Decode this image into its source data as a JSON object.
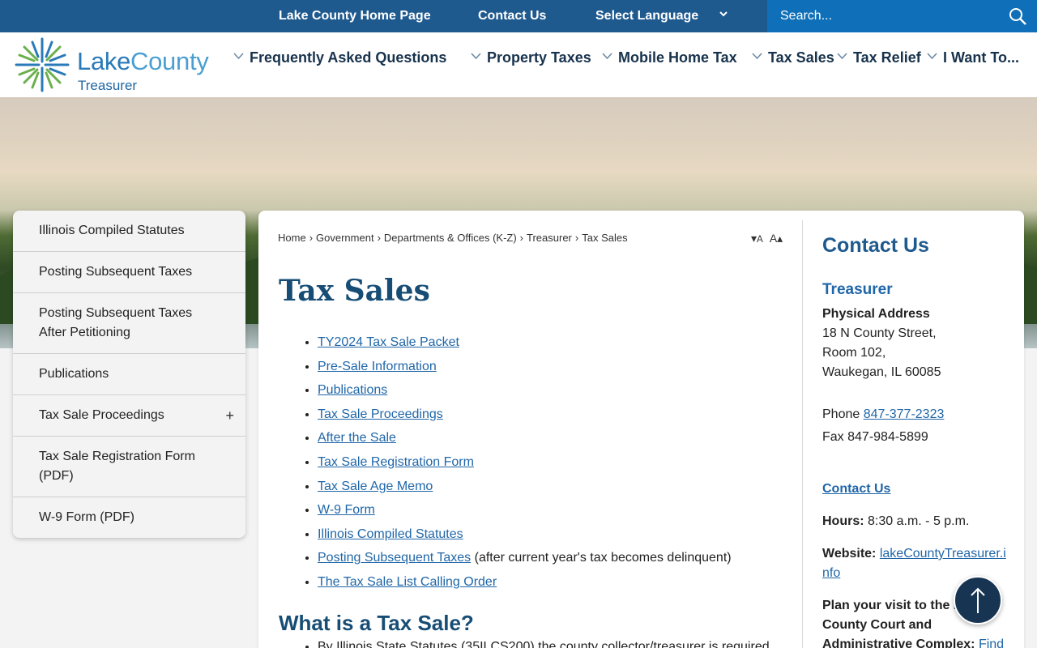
{
  "topbar": {
    "home_link": "Lake County Home Page",
    "contact_link": "Contact Us",
    "language": "Select Language",
    "search_placeholder": "Search..."
  },
  "logo": {
    "name_part1": "Lake",
    "name_part2": "County",
    "subtitle": "Treasurer"
  },
  "nav": [
    "Frequently Asked Questions",
    "Property Taxes",
    "Mobile Home Tax",
    "Tax Sales",
    "Tax Relief",
    "I Want To..."
  ],
  "sidenav": [
    "Illinois Compiled Statutes",
    "Posting Subsequent Taxes",
    "Posting Subsequent Taxes After Petitioning",
    "Publications",
    "Tax Sale Proceedings",
    "Tax Sale Registration Form (PDF)",
    "W-9 Form (PDF)"
  ],
  "breadcrumb": [
    "Home",
    "Government",
    "Departments & Offices (K-Z)",
    "Treasurer",
    "Tax Sales"
  ],
  "page_title": "Tax Sales",
  "links": [
    {
      "text": "TY2024 Tax Sale Packet",
      "suffix": ""
    },
    {
      "text": "Pre-Sale Information",
      "suffix": ""
    },
    {
      "text": "Publications",
      "suffix": ""
    },
    {
      "text": "Tax Sale Proceedings",
      "suffix": ""
    },
    {
      "text": "After the Sale",
      "suffix": ""
    },
    {
      "text": "Tax Sale Registration Form",
      "suffix": ""
    },
    {
      "text": "Tax Sale Age Memo",
      "suffix": ""
    },
    {
      "text": "W-9 Form",
      "suffix": ""
    },
    {
      "text": "Illinois Compiled Statutes",
      "suffix": ""
    },
    {
      "text": "Posting Subsequent Taxes",
      "suffix": " (after current year's tax becomes delinquent)"
    },
    {
      "text": "The Tax Sale List Calling Order",
      "suffix": ""
    }
  ],
  "section_title": "What is a Tax Sale?",
  "section_text": "By Illinois State Statutes (35ILCS200) the county collector/treasurer is required",
  "contact": {
    "title": "Contact Us",
    "office": "Treasurer",
    "address_label": "Physical Address",
    "address_line1": "18 N County Street,",
    "address_line2": "Room 102,",
    "address_line3": "Waukegan, IL 60085",
    "phone_label": "Phone",
    "phone": "847-377-2323",
    "fax": "Fax 847-984-5899",
    "contact_link": "Contact Us",
    "hours_label": "Hours:",
    "hours": "8:30 a.m. - 5 p.m.",
    "website_label": "Website:",
    "website": "lakeCountyTreasurer.info",
    "visit_text": "Plan your visit to the Lake County Court and Administrative Complex:",
    "visit_link": "Find"
  },
  "colors": {
    "topbar": "#1f5a8f",
    "search": "#0f6fb8",
    "title": "#174d75",
    "link": "#1f66a8"
  }
}
